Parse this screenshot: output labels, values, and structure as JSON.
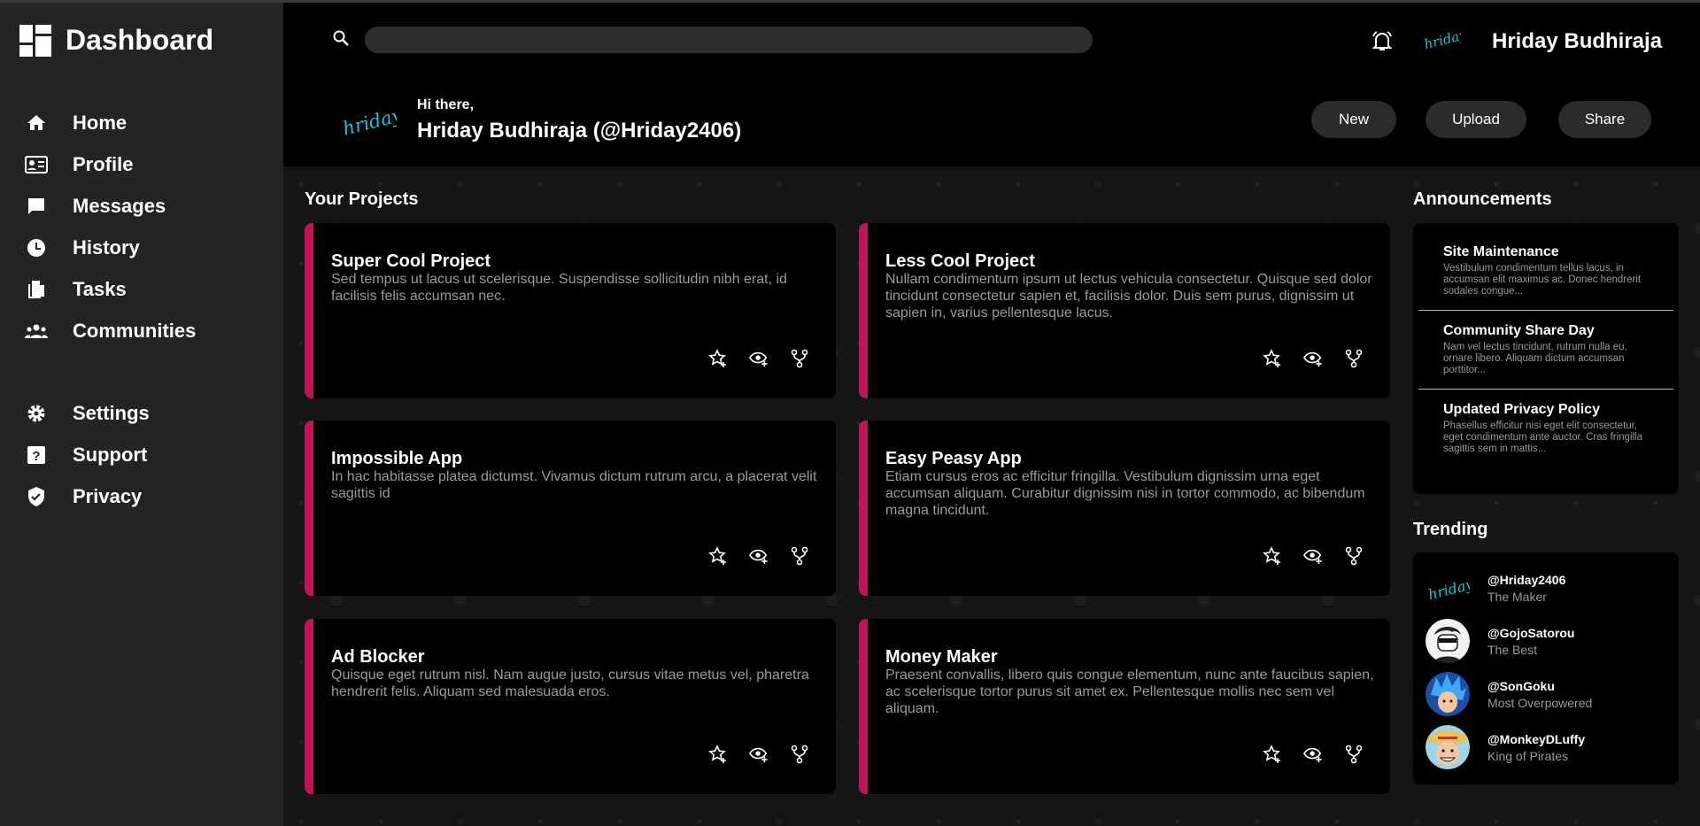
{
  "sidebar": {
    "brand": "Dashboard",
    "items": [
      {
        "label": "Home",
        "icon": "home-icon"
      },
      {
        "label": "Profile",
        "icon": "id-card-icon"
      },
      {
        "label": "Messages",
        "icon": "message-icon"
      },
      {
        "label": "History",
        "icon": "clock-icon"
      },
      {
        "label": "Tasks",
        "icon": "documents-icon"
      },
      {
        "label": "Communities",
        "icon": "people-icon"
      }
    ],
    "secondary": [
      {
        "label": "Settings",
        "icon": "gear-icon"
      },
      {
        "label": "Support",
        "icon": "help-icon"
      },
      {
        "label": "Privacy",
        "icon": "shield-icon"
      }
    ]
  },
  "topbar": {
    "search_value": "",
    "user_name": "Hriday Budhiraja",
    "avatar_text": "hriday"
  },
  "greeting": {
    "hi": "Hi there,",
    "name": "Hriday Budhiraja (@Hriday2406)",
    "buttons": {
      "new": "New",
      "upload": "Upload",
      "share": "Share"
    }
  },
  "projects": {
    "title": "Your Projects",
    "items": [
      {
        "title": "Super Cool Project",
        "desc": "Sed tempus ut lacus ut scelerisque. Suspendisse sollicitudin nibh erat, id facilisis felis accumsan nec."
      },
      {
        "title": "Less Cool Project",
        "desc": "Nullam condimentum ipsum ut lectus vehicula consectetur. Quisque sed dolor tincidunt consectetur sapien et, facilisis dolor. Duis sem purus, dignissim ut sapien in, varius pellentesque lacus."
      },
      {
        "title": "Impossible App",
        "desc": "In hac habitasse platea dictumst. Vivamus dictum rutrum arcu, a placerat velit sagittis id"
      },
      {
        "title": "Easy Peasy App",
        "desc": "Etiam cursus eros ac efficitur fringilla. Vestibulum dignissim urna eget accumsan aliquam. Curabitur dignissim nisi in tortor commodo, ac bibendum magna tincidunt."
      },
      {
        "title": "Ad Blocker",
        "desc": "Quisque eget rutrum nisl. Nam augue justo, cursus vitae metus vel, pharetra hendrerit felis. Aliquam sed malesuada eros."
      },
      {
        "title": "Money Maker",
        "desc": "Praesent convallis, libero quis congue elementum, nunc ante faucibus sapien, ac scelerisque tortor purus sit amet ex. Pellentesque mollis nec sem vel aliquam."
      }
    ]
  },
  "announcements": {
    "title": "Announcements",
    "items": [
      {
        "title": "Site Maintenance",
        "desc": "Vestibulum condimentum tellus lacus, in accumsan elit maximus ac. Donec hendrerit sodales congue..."
      },
      {
        "title": "Community Share Day",
        "desc": "Nam vel lectus tincidunt, rutrum nulla eu, ornare libero. Aliquam dictum accumsan porttitor..."
      },
      {
        "title": "Updated Privacy Policy",
        "desc": "Phasellus efficitur nisi eget elit consectetur, eget condimentum ante auctor. Cras fringilla sagittis sem in mattis..."
      }
    ]
  },
  "trending": {
    "title": "Trending",
    "items": [
      {
        "handle": "@Hriday2406",
        "sub": "The Maker"
      },
      {
        "handle": "@GojoSatorou",
        "sub": "The Best"
      },
      {
        "handle": "@SonGoku",
        "sub": "Most Overpowered"
      },
      {
        "handle": "@MonkeyDLuffy",
        "sub": "King of Pirates"
      }
    ]
  },
  "colors": {
    "accent": "#c0145a",
    "sidebar_bg": "#242424",
    "avatar_text": "#19c6d6"
  }
}
